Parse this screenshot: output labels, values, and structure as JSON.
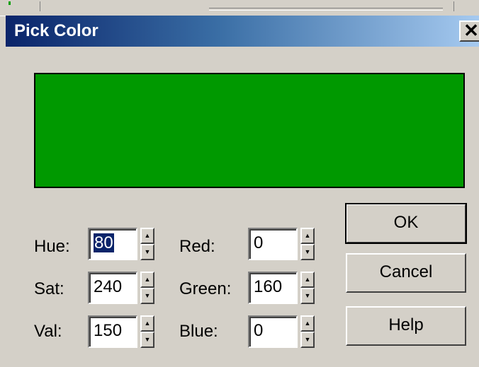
{
  "dialog": {
    "title": "Pick Color",
    "close_glyph": "✕",
    "preview_color": "#009900"
  },
  "fields": {
    "hue": {
      "label": "Hue:",
      "value": "80"
    },
    "sat": {
      "label": "Sat:",
      "value": "240"
    },
    "val": {
      "label": "Val:",
      "value": "150"
    },
    "red": {
      "label": "Red:",
      "value": "0"
    },
    "green": {
      "label": "Green:",
      "value": "160"
    },
    "blue": {
      "label": "Blue:",
      "value": "0"
    }
  },
  "spinner": {
    "up_glyph": "▲",
    "down_glyph": "▼"
  },
  "buttons": {
    "ok": "OK",
    "cancel": "Cancel",
    "help": "Help"
  }
}
